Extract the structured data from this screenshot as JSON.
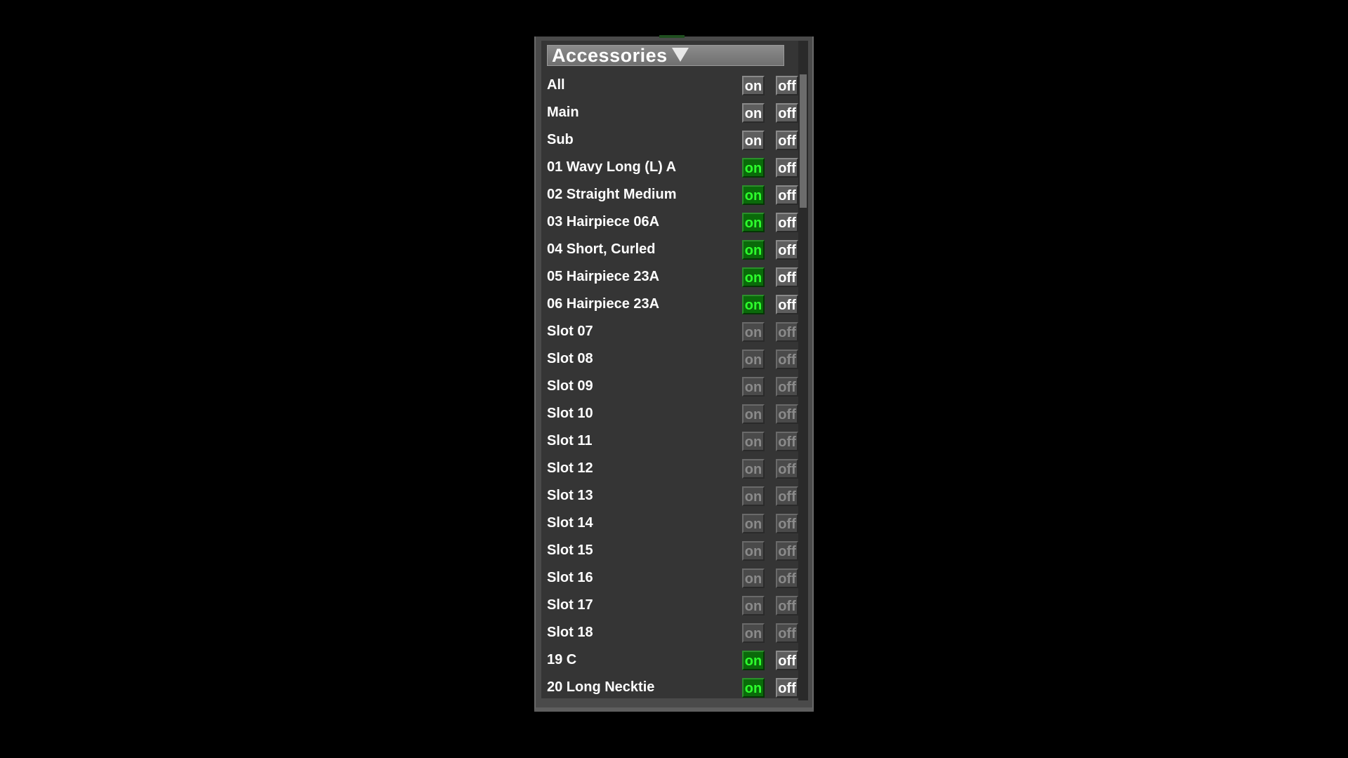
{
  "panel": {
    "title": "Accessories",
    "on_label": "on",
    "off_label": "off",
    "rows": [
      {
        "label": "All",
        "state": "neutral"
      },
      {
        "label": "Main",
        "state": "neutral"
      },
      {
        "label": "Sub",
        "state": "neutral"
      },
      {
        "label": "01 Wavy Long (L) A",
        "state": "on"
      },
      {
        "label": "02 Straight Medium",
        "state": "on"
      },
      {
        "label": "03 Hairpiece 06A",
        "state": "on"
      },
      {
        "label": "04 Short, Curled",
        "state": "on"
      },
      {
        "label": "05 Hairpiece 23A",
        "state": "on"
      },
      {
        "label": "06 Hairpiece 23A",
        "state": "on"
      },
      {
        "label": "Slot 07",
        "state": "disabled"
      },
      {
        "label": "Slot 08",
        "state": "disabled"
      },
      {
        "label": "Slot 09",
        "state": "disabled"
      },
      {
        "label": "Slot 10",
        "state": "disabled"
      },
      {
        "label": "Slot 11",
        "state": "disabled"
      },
      {
        "label": "Slot 12",
        "state": "disabled"
      },
      {
        "label": "Slot 13",
        "state": "disabled"
      },
      {
        "label": "Slot 14",
        "state": "disabled"
      },
      {
        "label": "Slot 15",
        "state": "disabled"
      },
      {
        "label": "Slot 16",
        "state": "disabled"
      },
      {
        "label": "Slot 17",
        "state": "disabled"
      },
      {
        "label": "Slot 18",
        "state": "disabled"
      },
      {
        "label": "19 C",
        "state": "on"
      },
      {
        "label": "20 Long Necktie",
        "state": "on"
      }
    ],
    "colors": {
      "active_on_bg": "#0a6a0a",
      "active_on_text": "#2dff2d",
      "panel_bg": "#353535",
      "header_bg": "#7c7c7c"
    },
    "icons": {
      "header_dropdown": "triangle-down-icon"
    }
  }
}
